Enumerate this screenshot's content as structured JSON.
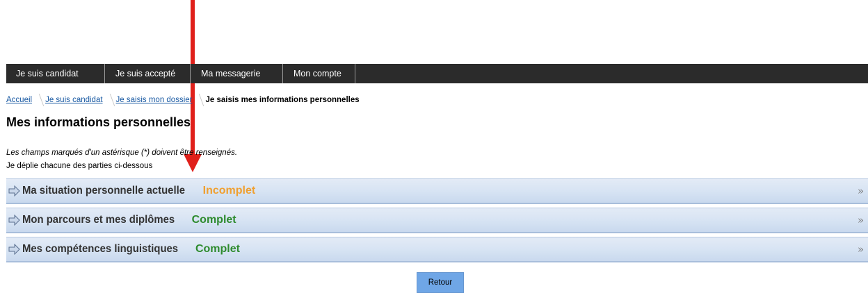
{
  "nav": {
    "items": [
      {
        "label": "Je suis candidat"
      },
      {
        "label": "Je suis accepté"
      },
      {
        "label": "Ma messagerie"
      },
      {
        "label": "Mon compte"
      }
    ]
  },
  "breadcrumb": {
    "links": [
      {
        "label": "Accueil"
      },
      {
        "label": "Je suis candidat"
      },
      {
        "label": "Je saisis mon dossier"
      }
    ],
    "current": "Je saisis mes informations personnelles"
  },
  "page": {
    "title": "Mes informations personnelles",
    "required_note": "Les champs marqués d'un astérisque (*) doivent être renseignés.",
    "instruction": "Je déplie chacune des parties ci-dessous"
  },
  "sections": [
    {
      "label": "Ma situation personnelle actuelle",
      "status": "Incomplet",
      "status_color": "#f0a030",
      "icon": "arrow-right-icon",
      "chevron": "»"
    },
    {
      "label": "Mon parcours et mes diplômes",
      "status": "Complet",
      "status_color": "#2e8b2e",
      "icon": "arrow-right-icon",
      "chevron": "»"
    },
    {
      "label": "Mes compétences linguistiques",
      "status": "Complet",
      "status_color": "#2e8b2e",
      "icon": "arrow-right-icon",
      "chevron": "»"
    }
  ],
  "buttons": {
    "back_label": "Retour"
  },
  "colors": {
    "nav_bg": "#2b2b2b",
    "annotation_arrow": "#e0201b",
    "button_bg": "#6fa6e6"
  }
}
